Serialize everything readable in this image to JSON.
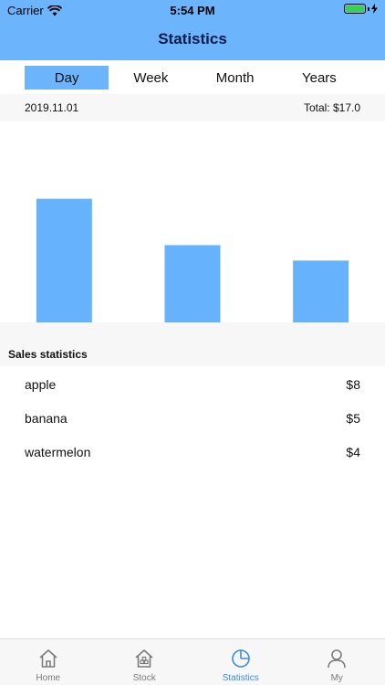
{
  "status_bar": {
    "carrier": "Carrier",
    "time": "5:54 PM"
  },
  "nav": {
    "title": "Statistics"
  },
  "tabs": [
    {
      "label": "Day",
      "active": true
    },
    {
      "label": "Week",
      "active": false
    },
    {
      "label": "Month",
      "active": false
    },
    {
      "label": "Years",
      "active": false
    }
  ],
  "info": {
    "date": "2019.11.01",
    "total": "Total: $17.0"
  },
  "chart_data": {
    "type": "bar",
    "categories": [
      "apple",
      "banana",
      "watermelon"
    ],
    "values": [
      8,
      5,
      4
    ],
    "ylim": [
      0,
      13
    ],
    "grid": false,
    "color": "#66b2fc"
  },
  "sales": {
    "title": "Sales statistics",
    "items": [
      {
        "name": "apple",
        "value": "$8"
      },
      {
        "name": "banana",
        "value": "$5"
      },
      {
        "name": "watermelon",
        "value": "$4"
      }
    ]
  },
  "tabbar": {
    "items": [
      {
        "label": "Home",
        "icon": "home-icon",
        "active": false
      },
      {
        "label": "Stock",
        "icon": "stock-icon",
        "active": false
      },
      {
        "label": "Statistics",
        "icon": "statistics-icon",
        "active": true
      },
      {
        "label": "My",
        "icon": "person-icon",
        "active": false
      }
    ]
  },
  "colors": {
    "accent": "#6cb4fb",
    "active_tab_text": "#3a8ee6"
  }
}
